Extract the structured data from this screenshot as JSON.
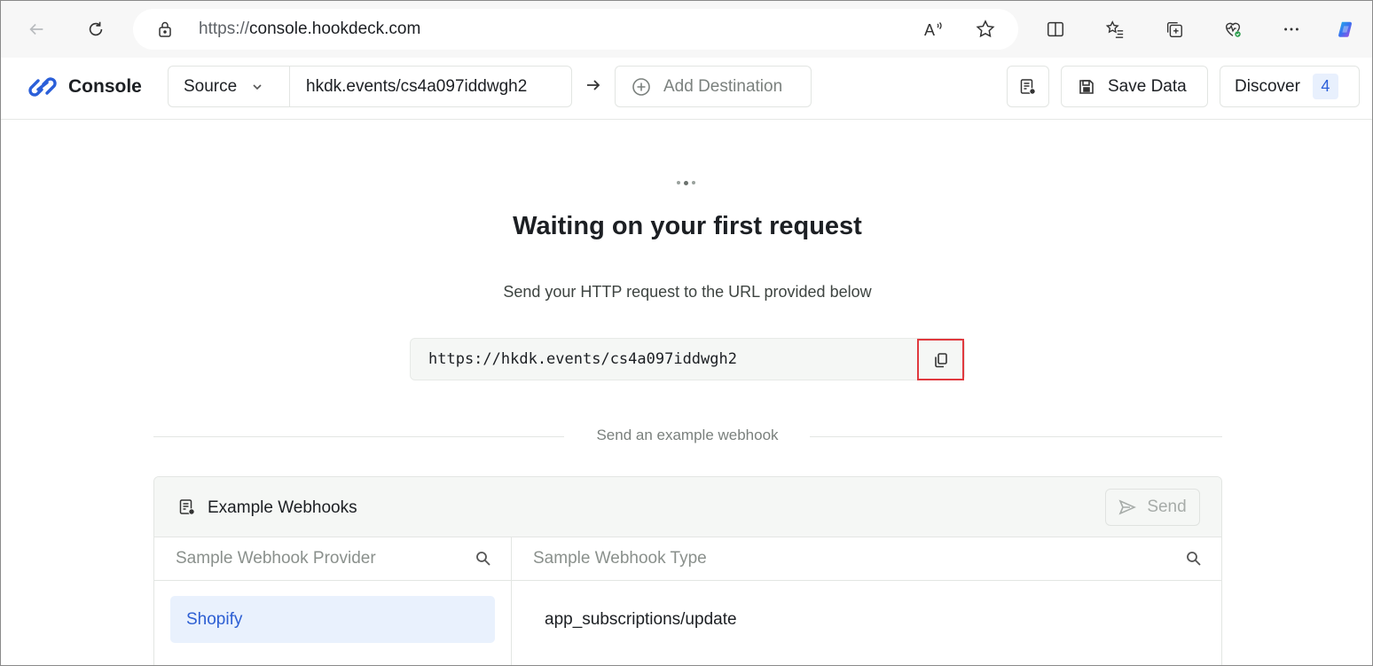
{
  "browser": {
    "url_proto": "https://",
    "url_host": "console.hookdeck.com",
    "icons": [
      "back-icon",
      "refresh-icon",
      "lock-icon",
      "read-aloud-icon",
      "favorite-star-icon",
      "split-screen-icon",
      "favorites-list-icon",
      "collections-icon",
      "browser-essentials-icon",
      "more-icon",
      "copilot-icon"
    ],
    "read_aloud_label": "A"
  },
  "header": {
    "logo_text": "Console",
    "source_label": "Source",
    "source_value": "hkdk.events/cs4a097iddwgh2",
    "add_destination_label": "Add Destination",
    "save_data_label": "Save Data",
    "discover_label": "Discover",
    "discover_count": "4"
  },
  "main": {
    "title": "Waiting on your first request",
    "subtitle": "Send your HTTP request to the URL provided below",
    "request_url": "https://hkdk.events/cs4a097iddwgh2",
    "divider_label": "Send an example webhook"
  },
  "examples": {
    "title": "Example Webhooks",
    "send_label": "Send",
    "provider_placeholder": "Sample Webhook Provider",
    "type_placeholder": "Sample Webhook Type",
    "providers": [
      "Shopify"
    ],
    "types": [
      "app_subscriptions/update"
    ]
  },
  "colors": {
    "accent_blue": "#2d5fd3",
    "highlight_red": "#e0393e",
    "selected_bg": "#e9f1fd"
  }
}
